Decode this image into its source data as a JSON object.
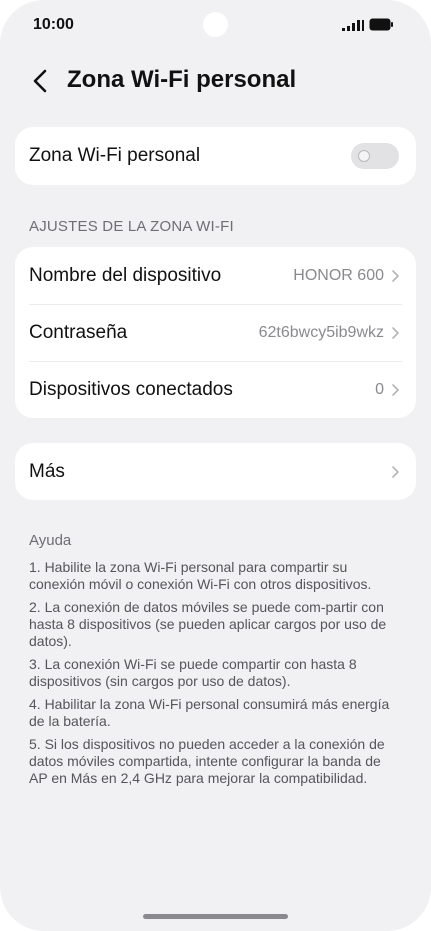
{
  "status_bar": {
    "time": "10:00"
  },
  "header": {
    "title": "Zona Wi-Fi personal"
  },
  "hotspot_toggle": {
    "label": "Zona Wi-Fi personal",
    "enabled": false
  },
  "section": {
    "title": "AJUSTES DE LA ZONA WI-FI"
  },
  "settings": [
    {
      "label": "Nombre del dispositivo",
      "value": "HONOR 600"
    },
    {
      "label": "Contraseña",
      "value": "62t6bwcy5ib9wkz"
    },
    {
      "label": "Dispositivos conectados",
      "value": "0"
    }
  ],
  "more": {
    "label": "Más"
  },
  "help": {
    "title": "Ayuda",
    "items": [
      "1. Habilite la zona Wi-Fi personal para compartir su conexión móvil o conexión Wi-Fi con otros dispositivos.",
      "2. La conexión de datos móviles se puede com-partir con hasta 8 dispositivos (se pueden aplicar cargos por uso de datos).",
      "3. La conexión Wi-Fi se puede compartir con hasta 8 dispositivos (sin cargos por uso de datos).",
      "4. Habilitar la zona Wi-Fi personal consumirá más energía de la batería.",
      "5. Si los dispositivos no pueden acceder a la conexión de datos móviles compartida, intente configurar la banda de AP en Más en 2,4 GHz para mejorar la compatibilidad."
    ]
  }
}
